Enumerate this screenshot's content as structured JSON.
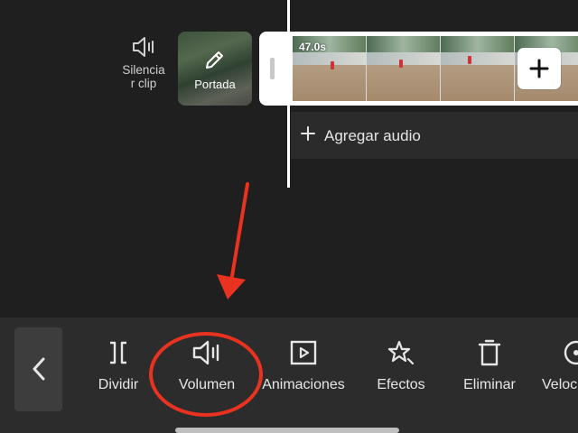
{
  "timeline": {
    "mute_clip_label": "Silencia\nr clip",
    "cover_label": "Portada",
    "clip_duration": "47.0s",
    "add_audio_label": "Agregar audio"
  },
  "toolbar": {
    "tools": [
      {
        "label": "Dividir",
        "icon": "split-icon"
      },
      {
        "label": "Volumen",
        "icon": "volume-icon"
      },
      {
        "label": "Animaciones",
        "icon": "animation-play-icon"
      },
      {
        "label": "Efectos",
        "icon": "effects-star-icon"
      },
      {
        "label": "Eliminar",
        "icon": "trash-icon"
      },
      {
        "label": "Veloc",
        "icon": "speed-icon"
      }
    ]
  },
  "annotation": {
    "color": "#ea3220",
    "highlighted_tool": "Volumen"
  },
  "colors": {
    "background": "#1f1f1f",
    "toolbar": "#2c2c2c",
    "playhead": "#ffffff"
  }
}
